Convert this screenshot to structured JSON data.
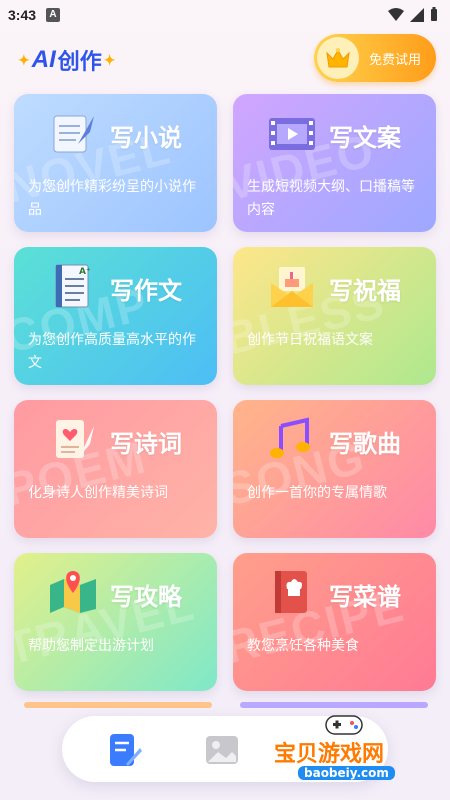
{
  "status_bar": {
    "time": "3:43",
    "notif_letter": "A"
  },
  "header": {
    "brand_ai": "AI",
    "brand_text": "创作",
    "trial_label": "免费试用"
  },
  "cards": [
    {
      "title": "写小说",
      "desc": "为您创作精彩纷呈的小说作品",
      "watermark": "NOVEL"
    },
    {
      "title": "写文案",
      "desc": "生成短视频大纲、口播稿等内容",
      "watermark": "VIDEO"
    },
    {
      "title": "写作文",
      "desc": "为您创作高质量高水平的作文",
      "watermark": "COMP"
    },
    {
      "title": "写祝福",
      "desc": "创作节日祝福语文案",
      "watermark": "BLESS"
    },
    {
      "title": "写诗词",
      "desc": "化身诗人创作精美诗词",
      "watermark": "POEM"
    },
    {
      "title": "写歌曲",
      "desc": "创作一首你的专属情歌",
      "watermark": "SONG"
    },
    {
      "title": "写攻略",
      "desc": "帮助您制定出游计划",
      "watermark": "TRAVEL"
    },
    {
      "title": "写菜谱",
      "desc": "教您烹饪各种美食",
      "watermark": "RECIPE"
    }
  ],
  "bottom_nav": {
    "tabs": [
      "write-icon",
      "image-icon"
    ]
  },
  "site_watermark": {
    "title": "宝贝游戏网",
    "url": "baobeiy.com"
  },
  "colors": {
    "brand_blue": "#2f54eb",
    "trial_orange": "#ff9d1a"
  }
}
